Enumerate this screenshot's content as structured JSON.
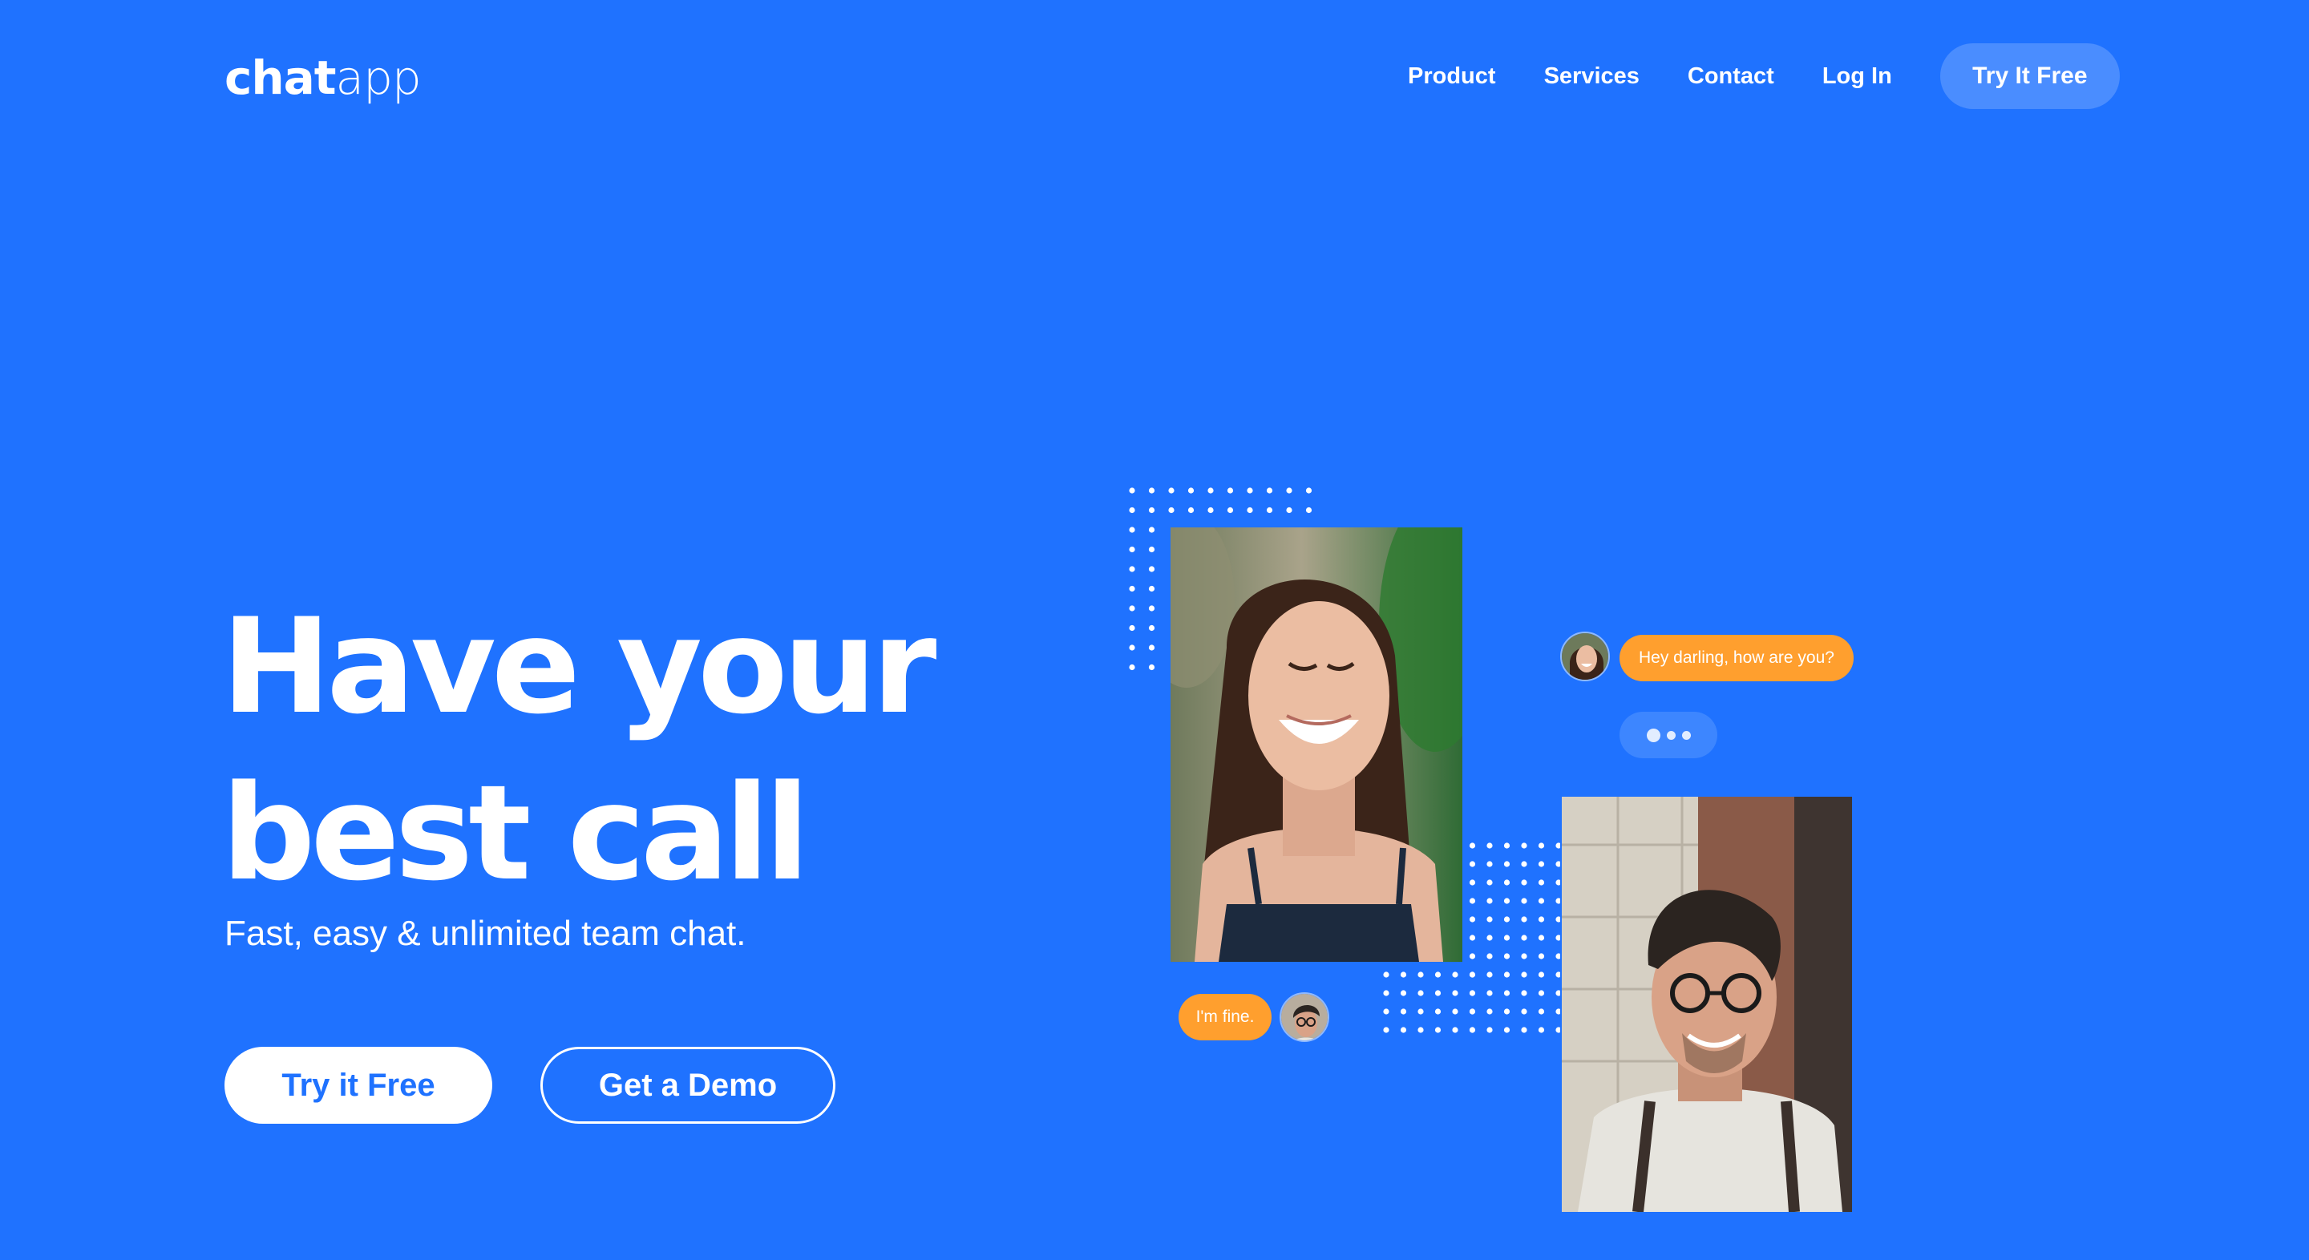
{
  "brand": {
    "logo_bold": "chat",
    "logo_light": "app"
  },
  "nav": {
    "items": [
      "Product",
      "Services",
      "Contact",
      "Log In"
    ],
    "cta": "Try It Free"
  },
  "hero": {
    "headline_line1": "Have your",
    "headline_line2": "best call",
    "subtitle": "Fast, easy & unlimited team chat.",
    "primary_button": "Try it Free",
    "secondary_button": "Get a Demo"
  },
  "chat": {
    "incoming_message": "Hey darling, how are you?",
    "reply_message": "I'm fine."
  },
  "colors": {
    "background": "#1f72ff",
    "accent": "#ff9f2e",
    "nav_cta": "#4a8dff",
    "text": "#ffffff"
  },
  "icons": [
    "typing-indicator-icon",
    "dot-pattern"
  ]
}
